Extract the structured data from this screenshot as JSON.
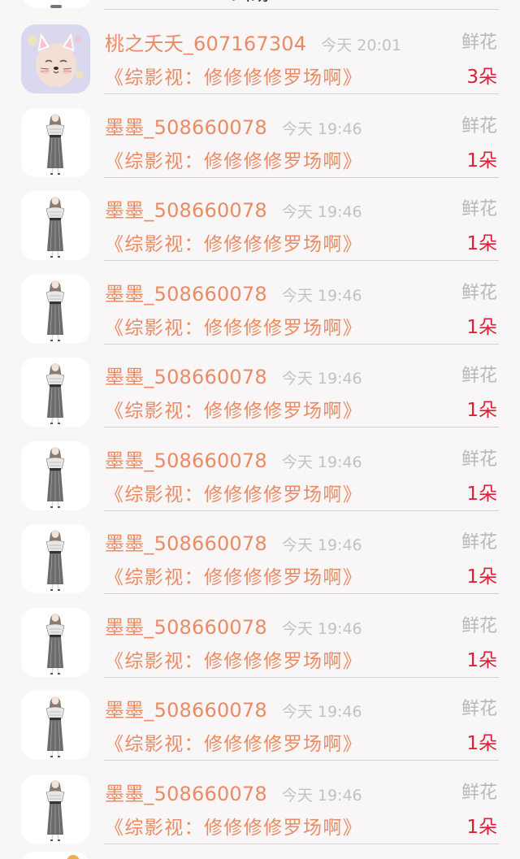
{
  "partial_top_text": "纠纷",
  "rows": [
    {
      "username": "桃之夭夭_607167304",
      "time": "今天 20:01",
      "gift": "鲜花",
      "title": "《综影视：修修修修罗场啊》",
      "count": "3朵",
      "avatar": "baby-cat-avatar"
    },
    {
      "username": "墨墨_508660078",
      "time": "今天 19:46",
      "gift": "鲜花",
      "title": "《综影视：修修修修罗场啊》",
      "count": "1朵",
      "avatar": "girl-illustration-avatar"
    },
    {
      "username": "墨墨_508660078",
      "time": "今天 19:46",
      "gift": "鲜花",
      "title": "《综影视：修修修修罗场啊》",
      "count": "1朵",
      "avatar": "girl-illustration-avatar"
    },
    {
      "username": "墨墨_508660078",
      "time": "今天 19:46",
      "gift": "鲜花",
      "title": "《综影视：修修修修罗场啊》",
      "count": "1朵",
      "avatar": "girl-illustration-avatar"
    },
    {
      "username": "墨墨_508660078",
      "time": "今天 19:46",
      "gift": "鲜花",
      "title": "《综影视：修修修修罗场啊》",
      "count": "1朵",
      "avatar": "girl-illustration-avatar"
    },
    {
      "username": "墨墨_508660078",
      "time": "今天 19:46",
      "gift": "鲜花",
      "title": "《综影视：修修修修罗场啊》",
      "count": "1朵",
      "avatar": "girl-illustration-avatar"
    },
    {
      "username": "墨墨_508660078",
      "time": "今天 19:46",
      "gift": "鲜花",
      "title": "《综影视：修修修修罗场啊》",
      "count": "1朵",
      "avatar": "girl-illustration-avatar"
    },
    {
      "username": "墨墨_508660078",
      "time": "今天 19:46",
      "gift": "鲜花",
      "title": "《综影视：修修修修罗场啊》",
      "count": "1朵",
      "avatar": "girl-illustration-avatar"
    },
    {
      "username": "墨墨_508660078",
      "time": "今天 19:46",
      "gift": "鲜花",
      "title": "《综影视：修修修修罗场啊》",
      "count": "1朵",
      "avatar": "girl-illustration-avatar"
    },
    {
      "username": "墨墨_508660078",
      "time": "今天 19:46",
      "gift": "鲜花",
      "title": "《综影视：修修修修罗场啊》",
      "count": "1朵",
      "avatar": "girl-illustration-avatar"
    }
  ],
  "colors": {
    "background": "#f8f6f7",
    "username": "#eb8b64",
    "title": "#eb8b64",
    "count": "#dc2038",
    "muted": "#c3c1c3",
    "divider": "#d2d0d2"
  }
}
